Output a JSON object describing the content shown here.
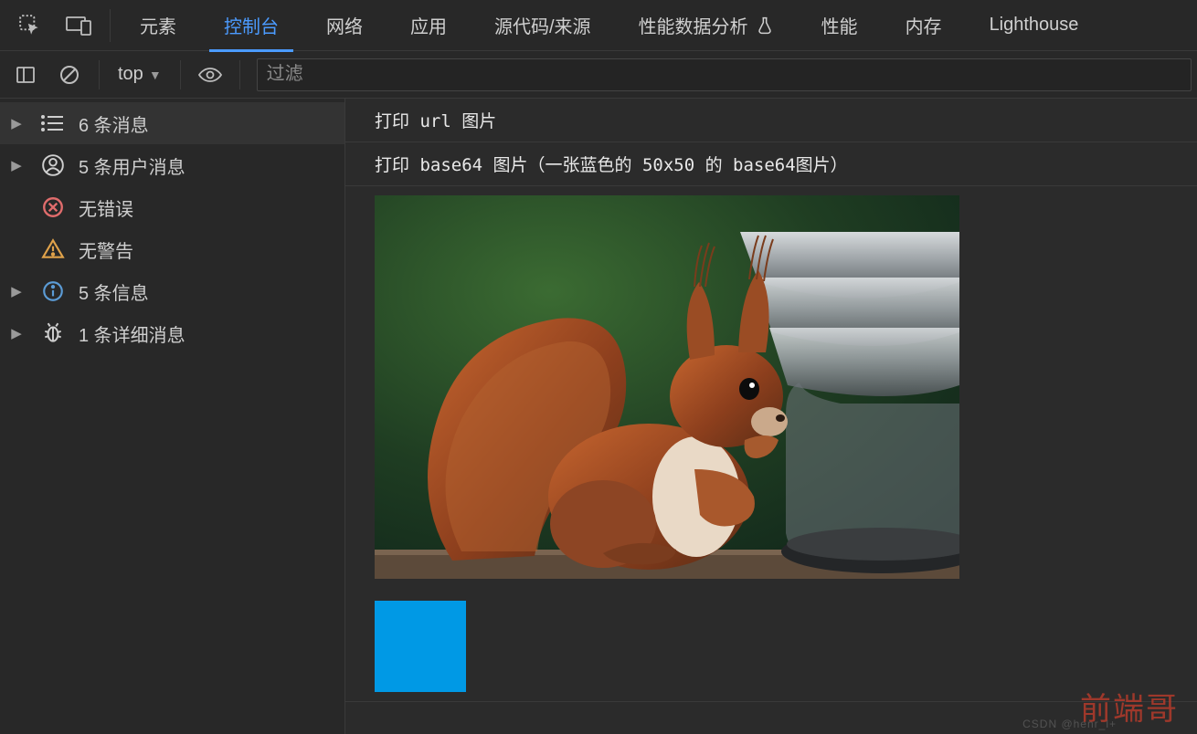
{
  "tabs": {
    "items": [
      {
        "label": "元素"
      },
      {
        "label": "控制台"
      },
      {
        "label": "网络"
      },
      {
        "label": "应用"
      },
      {
        "label": "源代码/来源"
      },
      {
        "label": "性能数据分析"
      },
      {
        "label": "性能"
      },
      {
        "label": "内存"
      },
      {
        "label": "Lighthouse"
      }
    ],
    "active_index": 1
  },
  "toolbar": {
    "context_label": "top",
    "filter_placeholder": "过滤"
  },
  "sidebar": {
    "items": [
      {
        "label": "6 条消息",
        "icon": "list",
        "has_arrow": true,
        "highlight": true
      },
      {
        "label": "5 条用户消息",
        "icon": "user",
        "has_arrow": true,
        "highlight": false
      },
      {
        "label": "无错误",
        "icon": "error",
        "has_arrow": false,
        "highlight": false
      },
      {
        "label": "无警告",
        "icon": "warning",
        "has_arrow": false,
        "highlight": false
      },
      {
        "label": "5 条信息",
        "icon": "info",
        "has_arrow": true,
        "highlight": false
      },
      {
        "label": "1 条详细消息",
        "icon": "verbose",
        "has_arrow": true,
        "highlight": false
      }
    ]
  },
  "console": {
    "logs": [
      {
        "text": "打印 url 图片"
      },
      {
        "text": "打印 base64 图片（一张蓝色的 50x50 的 base64图片）"
      }
    ],
    "blue_square_color": "#0099e5"
  },
  "watermark": {
    "text": "前端哥",
    "sub": "CSDN @henr_l+"
  }
}
